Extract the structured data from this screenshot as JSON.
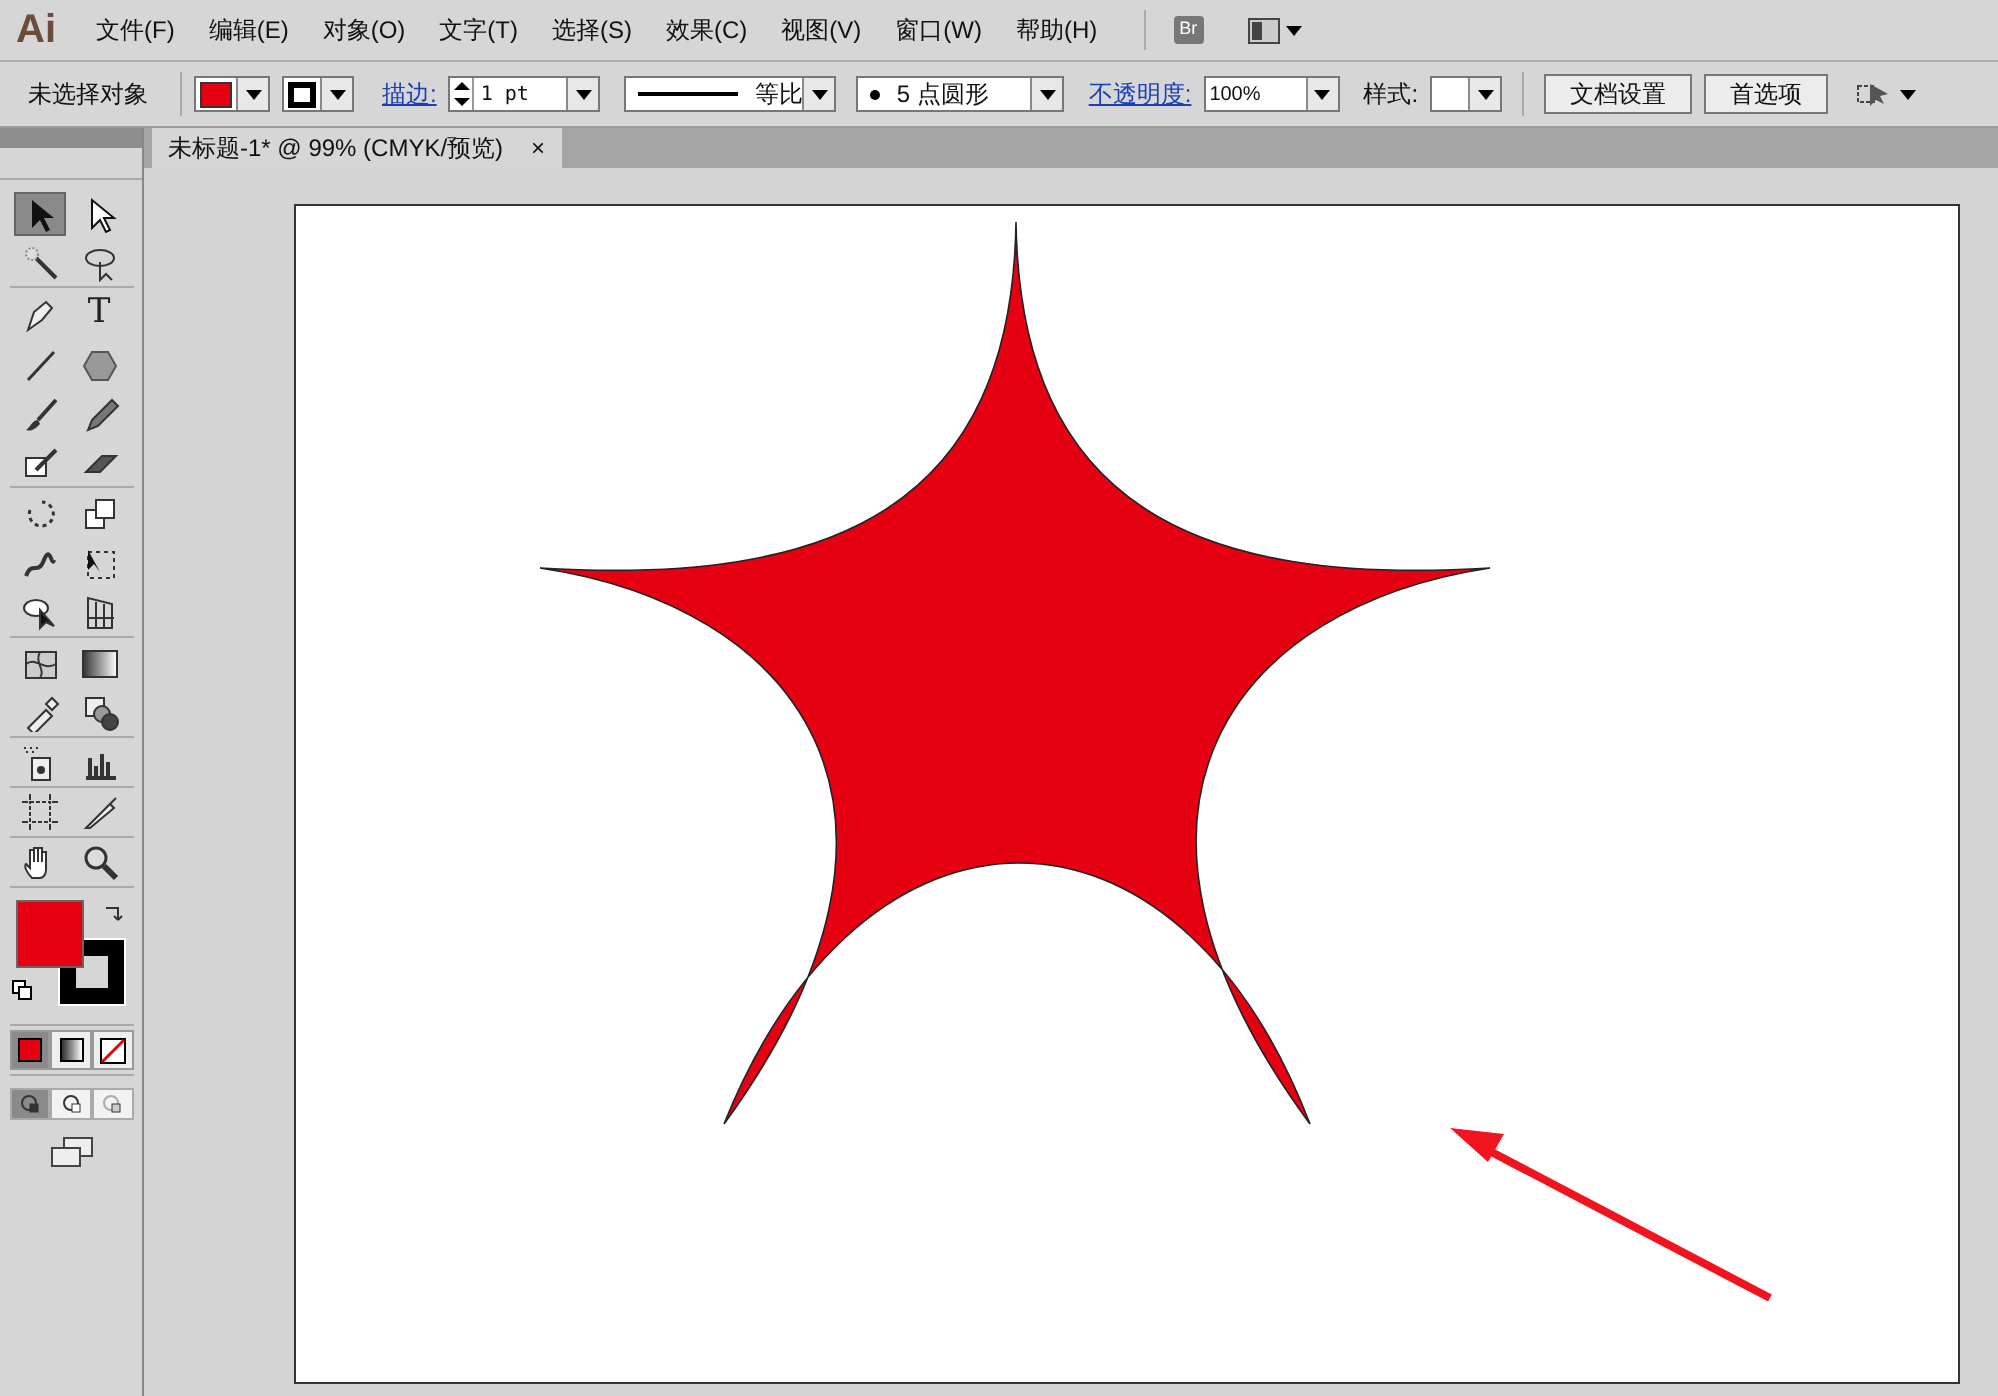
{
  "app_logo": "Ai",
  "menu": [
    "文件(F)",
    "编辑(E)",
    "对象(O)",
    "文字(T)",
    "选择(S)",
    "效果(C)",
    "视图(V)",
    "窗口(W)",
    "帮助(H)"
  ],
  "bridge_button": "Br",
  "control_bar": {
    "selection_label": "未选择对象",
    "stroke_label": "描边:",
    "stroke_weight": "1 pt",
    "profile": "等比",
    "brush": "5 点圆形",
    "opacity_label": "不透明度:",
    "opacity": "100%",
    "style_label": "样式:",
    "buttons": [
      "文档设置",
      "首选项"
    ]
  },
  "document_tab": {
    "title": "未标题-1* @ 99% (CMYK/预览)",
    "close": "×"
  },
  "tools": [
    {
      "kind": "selection",
      "selected": true
    },
    {
      "kind": "direct-selection",
      "selected": false
    },
    {
      "kind": "magic-wand",
      "selected": false
    },
    {
      "kind": "lasso",
      "selected": false
    },
    {
      "kind": "pen",
      "selected": false
    },
    {
      "kind": "type",
      "glyph": "T",
      "selected": false
    },
    {
      "kind": "line",
      "selected": false
    },
    {
      "kind": "polygon",
      "selected": false
    },
    {
      "kind": "brush",
      "selected": false
    },
    {
      "kind": "pencil",
      "selected": false
    },
    {
      "kind": "blob",
      "selected": false
    },
    {
      "kind": "eraser",
      "selected": false
    },
    {
      "kind": "rotate",
      "selected": false
    },
    {
      "kind": "scale",
      "selected": false
    },
    {
      "kind": "warp",
      "selected": false
    },
    {
      "kind": "free-transform",
      "selected": false
    },
    {
      "kind": "shape-builder",
      "selected": false
    },
    {
      "kind": "perspective",
      "selected": false
    },
    {
      "kind": "mesh",
      "selected": false
    },
    {
      "kind": "gradient",
      "selected": false
    },
    {
      "kind": "eyedropper",
      "selected": false
    },
    {
      "kind": "blend",
      "selected": false
    },
    {
      "kind": "symbol-sprayer",
      "selected": false
    },
    {
      "kind": "graph",
      "selected": false
    },
    {
      "kind": "artboard",
      "selected": false
    },
    {
      "kind": "slice",
      "selected": false
    },
    {
      "kind": "hand",
      "selected": false
    },
    {
      "kind": "zoom",
      "selected": false
    }
  ],
  "color_modes": [
    {
      "kind": "color",
      "selected": true
    },
    {
      "kind": "gradient",
      "selected": false
    },
    {
      "kind": "none",
      "selected": false
    }
  ],
  "draw_modes": [
    {
      "kind": "normal",
      "selected": true
    },
    {
      "kind": "behind",
      "selected": false
    },
    {
      "kind": "inside",
      "selected": false
    }
  ]
}
